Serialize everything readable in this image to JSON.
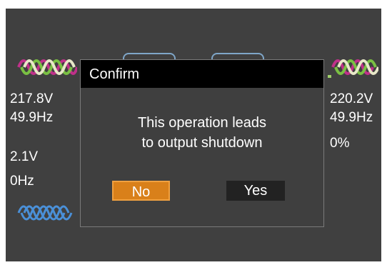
{
  "input": {
    "voltage": "217.8V",
    "frequency": "49.9Hz"
  },
  "bypass": {
    "voltage": "2.1V",
    "frequency": "0Hz"
  },
  "output": {
    "voltage": "220.2V",
    "frequency": "49.9Hz",
    "load": "0%"
  },
  "dialog": {
    "title": "Confirm",
    "message_line1": "This operation leads",
    "message_line2": "to output shutdown",
    "no_label": "No",
    "yes_label": "Yes"
  },
  "colors": {
    "screen_bg": "#404040",
    "dialog_header": "#000000",
    "selected_button": "#d9801a",
    "wave_magenta": "#c0308a",
    "wave_green": "#7ac043",
    "wave_cream": "#e8e8c8",
    "wave_blue": "#4a90d8"
  },
  "icons": {
    "input_wave": "three-phase-sine-wave-icon",
    "bypass_wave": "three-phase-sine-wave-icon",
    "output_wave": "three-phase-sine-wave-icon"
  }
}
